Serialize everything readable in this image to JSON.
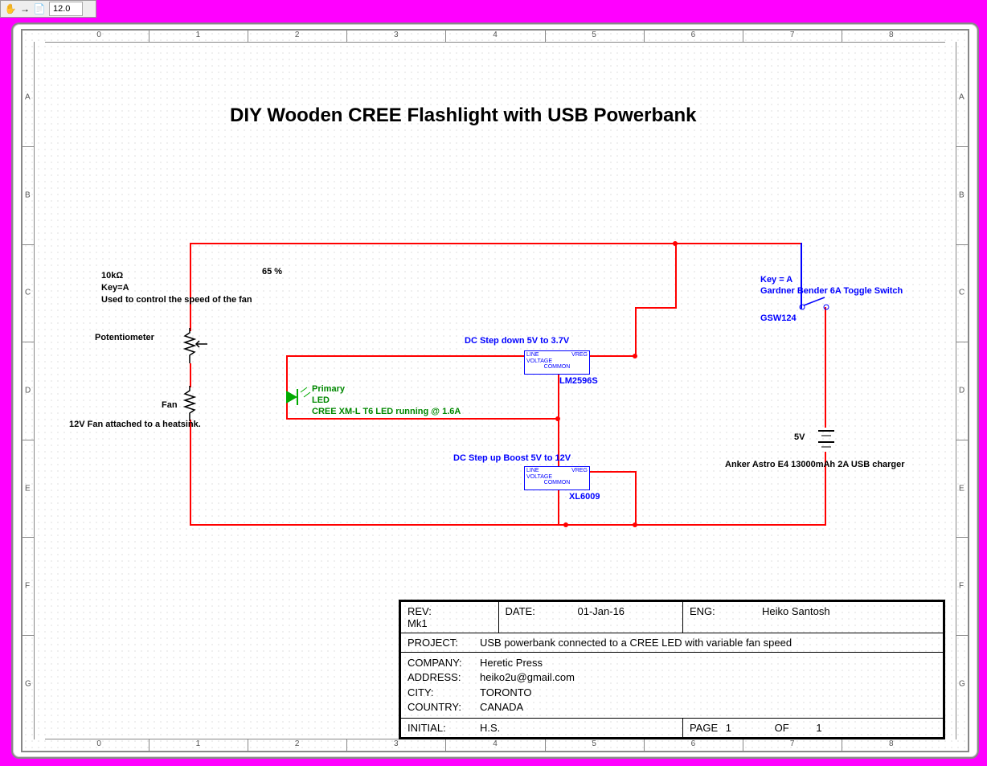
{
  "toolbar": {
    "zoom": "12.0"
  },
  "ruler": {
    "h": [
      "0",
      "1",
      "2",
      "3",
      "4",
      "5",
      "6",
      "7",
      "8"
    ],
    "v": [
      "A",
      "B",
      "C",
      "D",
      "E",
      "F",
      "G"
    ]
  },
  "schematic": {
    "title": "DIY Wooden CREE  Flashlight with USB Powerbank",
    "pot": {
      "value": "10kΩ",
      "key": "Key=A",
      "desc": "Used to control the speed of the fan",
      "name": "Potentiometer",
      "setting": "65 %"
    },
    "fan": {
      "name": "Fan",
      "desc": "12V Fan attached to a heatsink."
    },
    "led": {
      "label1": "Primary",
      "label2": "LED",
      "desc": "CREE XM-L T6 LED running @ 1.6A"
    },
    "stepdown": {
      "title": "DC Step down 5V to 3.7V",
      "part": "LM2596S",
      "pins": {
        "line": "LINE",
        "vreg": "VREG",
        "voltage": "VOLTAGE",
        "common": "COMMON"
      }
    },
    "stepup": {
      "title": "DC Step up Boost 5V to 12V",
      "part": "XL6009",
      "pins": {
        "line": "LINE",
        "vreg": "VREG",
        "voltage": "VOLTAGE",
        "common": "COMMON"
      }
    },
    "switch": {
      "key": "Key = A",
      "desc": "Gardner Bender 6A Toggle Switch",
      "part": "GSW124"
    },
    "battery": {
      "voltage": "5V",
      "desc": "Anker Astro E4 13000mAh 2A USB charger"
    }
  },
  "titleblock": {
    "rev_k": "REV:",
    "rev_v": "Mk1",
    "date_k": "DATE:",
    "date_v": "01-Jan-16",
    "eng_k": "ENG:",
    "eng_v": "Heiko Santosh",
    "project_k": "PROJECT:",
    "project_v": "USB powerbank connected to a CREE LED with variable fan speed",
    "company_k": "COMPANY:",
    "company_v": "Heretic Press",
    "address_k": "ADDRESS:",
    "address_v": "heiko2u@gmail.com",
    "city_k": "CITY:",
    "city_v": "TORONTO",
    "country_k": "COUNTRY:",
    "country_v": "CANADA",
    "initial_k": "INITIAL:",
    "initial_v": "H.S.",
    "page_k": "PAGE",
    "page_v": "1",
    "of_k": "OF",
    "of_v": "1"
  }
}
